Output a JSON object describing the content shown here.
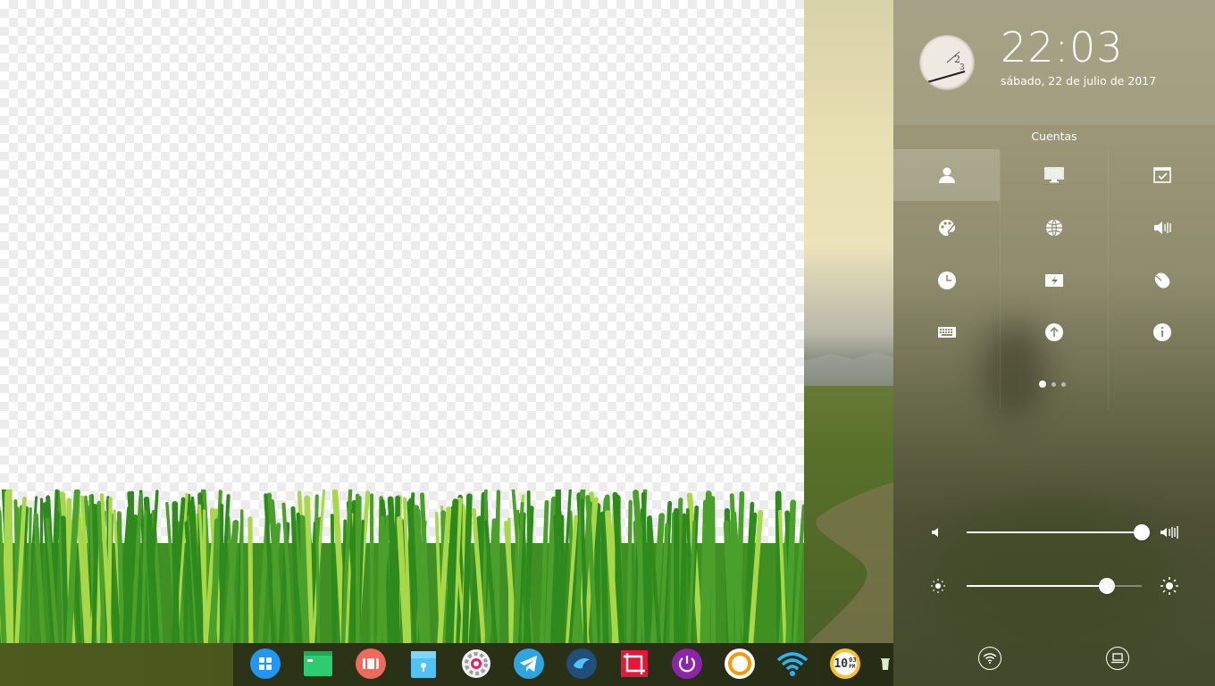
{
  "control_center": {
    "clock": "22:03",
    "date": "sábado, 22 de julio de 2017",
    "section_title": "Cuentas",
    "tiles": [
      {
        "name": "accounts",
        "icon": "user-icon",
        "active": true
      },
      {
        "name": "display",
        "icon": "monitor-icon",
        "active": false
      },
      {
        "name": "default-applications",
        "icon": "calendar-check-icon",
        "active": false
      },
      {
        "name": "personalization",
        "icon": "palette-icon",
        "active": false
      },
      {
        "name": "network",
        "icon": "network-globe-icon",
        "active": false
      },
      {
        "name": "sound",
        "icon": "speaker-icon",
        "active": false
      },
      {
        "name": "date-time",
        "icon": "clock-icon",
        "active": false
      },
      {
        "name": "power",
        "icon": "battery-charging-icon",
        "active": false
      },
      {
        "name": "mouse",
        "icon": "mouse-icon",
        "active": false
      },
      {
        "name": "keyboard",
        "icon": "keyboard-icon",
        "active": false
      },
      {
        "name": "update",
        "icon": "upload-arrow-icon",
        "active": false
      },
      {
        "name": "system-info",
        "icon": "info-icon",
        "active": false
      }
    ],
    "page_count": 3,
    "current_page": 1,
    "volume_level": 1.0,
    "brightness_level": 0.8,
    "bottom_buttons": [
      "wifi-icon",
      "display-mode-icon"
    ]
  },
  "dock": {
    "items": [
      {
        "name": "launcher",
        "icon": "launcher-grid-icon",
        "color": "#2196f3"
      },
      {
        "name": "terminal",
        "icon": "terminal-icon",
        "color": "#2ecc71"
      },
      {
        "name": "multitasking",
        "icon": "multitask-icon",
        "color": "#ef6a5a"
      },
      {
        "name": "file-manager",
        "icon": "folder-icon",
        "color": "#4fc3f7"
      },
      {
        "name": "settings",
        "icon": "gear-icon",
        "color": "#e8e8e8"
      },
      {
        "name": "telegram",
        "icon": "telegram-icon",
        "color": "#2ca5e0"
      },
      {
        "name": "deepin-app",
        "icon": "bird-icon",
        "color": "#1f4f7a"
      },
      {
        "name": "screenshot",
        "icon": "crop-icon",
        "color": "#e8173a"
      },
      {
        "name": "shutdown",
        "icon": "power-icon",
        "color": "#8e24aa"
      },
      {
        "name": "browser",
        "icon": "browser-ring-icon",
        "color": "#ff9800"
      },
      {
        "name": "network",
        "icon": "wifi-icon",
        "color": "#29b6f6"
      },
      {
        "name": "clock",
        "icon": "digital-clock-icon",
        "color": "#fbc02d",
        "text_main": "10",
        "text_min": "03",
        "text_ampm": "PM"
      },
      {
        "name": "trash",
        "icon": "trash-icon",
        "color": "#c5e1a5"
      }
    ]
  }
}
